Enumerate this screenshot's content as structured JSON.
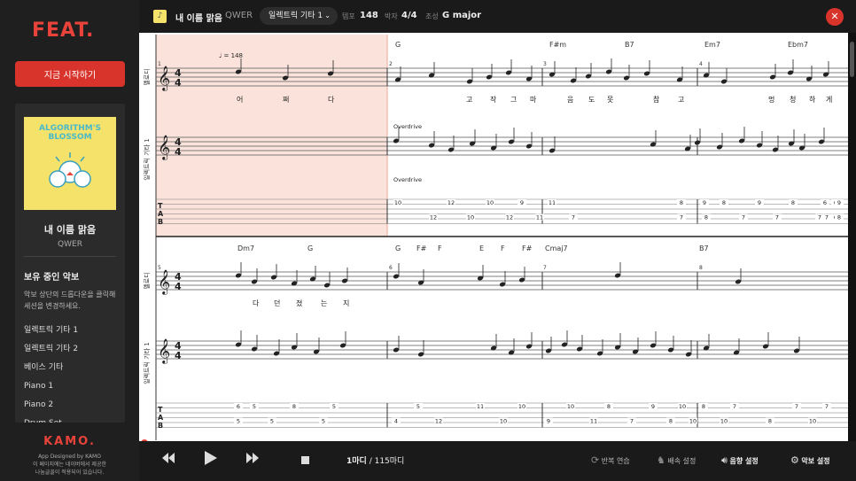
{
  "sidebar": {
    "logo": "FEAT.",
    "start_button": "지금 시작하기",
    "album_title": "ALGORITHM'S BLOSSOM",
    "song_title": "내 이름 맑음",
    "song_artist": "QWER",
    "owned_heading": "보유 중인 악보",
    "owned_desc": "악보 상단의 드롭다운을 클릭해 세션을 변경하세요.",
    "tracks": [
      "일렉트릭 기타 1",
      "일렉트릭 기타 2",
      "베이스 기타",
      "Piano 1",
      "Piano 2",
      "Drum Set"
    ],
    "brand": "KAMO.",
    "credit_line1": "App Designed by KAMO",
    "credit_line2": "이 페이지에는 네이버에서 제공한",
    "credit_line3": "나눔글꼴이 적용되어 있습니다."
  },
  "topbar": {
    "title": "내 이름 맑음",
    "artist": "QWER",
    "track_selected": "일렉트릭 기타 1",
    "tempo_label": "템포",
    "tempo_value": "148",
    "time_label": "박자",
    "time_value": "4/4",
    "key_label": "조성",
    "key_value": "G major"
  },
  "score": {
    "tempo_mark": "♩ = 148",
    "melody_label": "멜로디",
    "guitar_label": "일렉트릭 기타 1",
    "overdrive": "Overdrive",
    "system1": {
      "chords": [
        "G",
        "F#m",
        "B7",
        "Em7",
        "Ebm7"
      ],
      "measures": [
        "1",
        "2",
        "3",
        "4"
      ],
      "lyrics": [
        "어",
        "쩌",
        "다",
        "고",
        "작",
        "그",
        "마",
        "음",
        "도",
        "못",
        "참",
        "고",
        "멍",
        "청",
        "하",
        "게"
      ],
      "tab_nums": [
        "10",
        "12",
        "12",
        "10",
        "10",
        "12",
        "9",
        "11",
        "11",
        "7",
        "8",
        "7",
        "9",
        "8",
        "8",
        "7",
        "9",
        "7",
        "8",
        "7",
        "6",
        "7",
        "6",
        "6",
        "9",
        "8"
      ]
    },
    "system2": {
      "chords": [
        "Dm7",
        "G",
        "G",
        "F#",
        "F",
        "E",
        "F",
        "F#",
        "Cmaj7",
        "B7"
      ],
      "measures": [
        "5",
        "6",
        "7",
        "8"
      ],
      "lyrics": [
        "다",
        "던",
        "졌",
        "는",
        "지"
      ],
      "tab_nums": [
        "6",
        "5",
        "5",
        "5",
        "8",
        "5",
        "5",
        "4",
        "5",
        "12",
        "11",
        "10",
        "10",
        "9",
        "10",
        "11",
        "8",
        "7",
        "9",
        "8",
        "10",
        "10",
        "8",
        "10",
        "7",
        "8",
        "7",
        "10",
        "7"
      ]
    }
  },
  "bottombar": {
    "measure_current": "1마디",
    "measure_total": "/ 115마디",
    "repeat": "반복 연습",
    "speed": "배속 설정",
    "volume": "음향 설정",
    "settings": "악보 설정"
  },
  "colors": {
    "accent": "#d9342b",
    "highlight": "#fbe3dc"
  }
}
